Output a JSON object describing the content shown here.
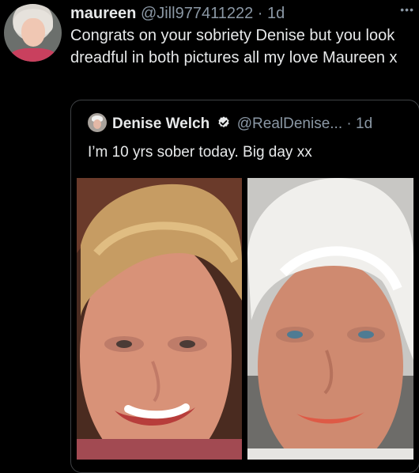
{
  "tweet": {
    "display_name": "maureen",
    "handle": "@Jill977411222",
    "separator": "·",
    "time": "1d",
    "more_icon": "more-horizontal-icon",
    "text": "Congrats on your sobriety Denise but you look dreadful in both pictures all my love Maureen x"
  },
  "quote": {
    "display_name": "Denise Welch",
    "verified_icon": "verified-badge-icon",
    "handle": "@RealDenise...",
    "separator": "·",
    "time": "1d",
    "text": "I’m 10 yrs sober today. Big day xx",
    "photos": [
      "before-photo",
      "after-photo"
    ]
  },
  "colors": {
    "background": "#000000",
    "text": "#e7e9ea",
    "secondary_text": "#8b98a5",
    "verified": "#e7e9ea",
    "quote_border": "#3e4144"
  }
}
